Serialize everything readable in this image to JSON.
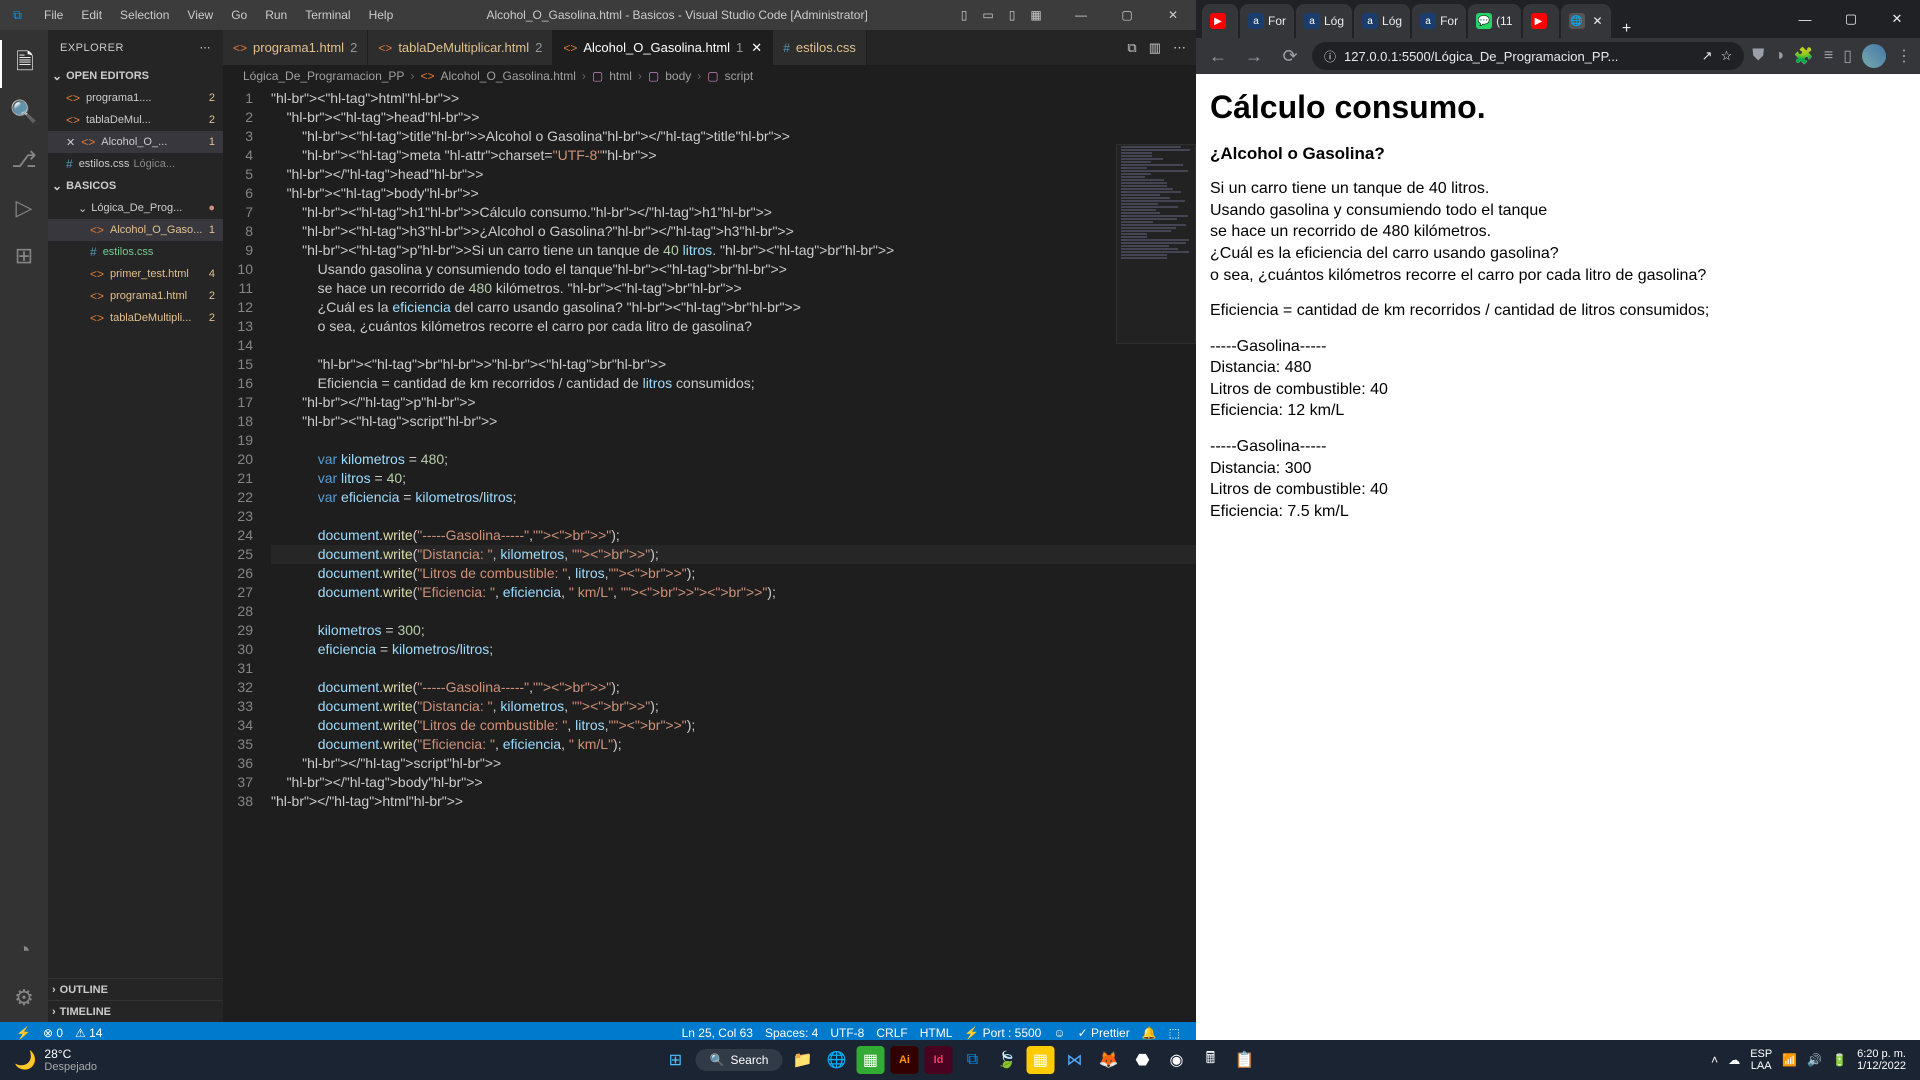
{
  "vscode": {
    "title": "Alcohol_O_Gasolina.html - Basicos - Visual Studio Code [Administrator]",
    "menu": [
      "File",
      "Edit",
      "Selection",
      "View",
      "Go",
      "Run",
      "Terminal",
      "Help"
    ],
    "explorer": {
      "title": "EXPLORER",
      "open_editors": "OPEN EDITORS",
      "workspace": "BASICOS",
      "folder": "Lógica_De_Prog...",
      "editors": [
        {
          "name": "programa1....",
          "badge": "2",
          "icon": "<>"
        },
        {
          "name": "tablaDeMul...",
          "badge": "2",
          "icon": "<>"
        },
        {
          "name": "Alcohol_O_...",
          "badge": "1",
          "icon": "<>",
          "sel": true,
          "close": true
        },
        {
          "name": "estilos.css",
          "sub": "Lógica...",
          "icon": "#",
          "blue": true
        }
      ],
      "files": [
        {
          "name": "Alcohol_O_Gaso...",
          "badge": "1",
          "cls": "git-m",
          "sel": true
        },
        {
          "name": "estilos.css",
          "icon": "#",
          "blue": true,
          "cls": "git-u"
        },
        {
          "name": "primer_test.html",
          "badge": "4",
          "cls": "git-m"
        },
        {
          "name": "programa1.html",
          "badge": "2",
          "cls": "git-m"
        },
        {
          "name": "tablaDeMultipli...",
          "badge": "2",
          "cls": "git-m"
        }
      ],
      "outline": "OUTLINE",
      "timeline": "TIMELINE"
    },
    "tabs": [
      {
        "name": "programa1.html",
        "badge": "2"
      },
      {
        "name": "tablaDeMultiplicar.html",
        "badge": "2"
      },
      {
        "name": "Alcohol_O_Gasolina.html",
        "badge": "1",
        "active": true,
        "close": true
      },
      {
        "name": "estilos.css",
        "blue": true,
        "icon": "#"
      }
    ],
    "breadcrumb": [
      "Lógica_De_Programacion_PP",
      "Alcohol_O_Gasolina.html",
      "html",
      "body",
      "script"
    ],
    "status": {
      "remote": "⚡",
      "err": "⊗ 0",
      "warn": "⚠ 14",
      "pos": "Ln 25, Col 63",
      "spaces": "Spaces: 4",
      "enc": "UTF-8",
      "eol": "CRLF",
      "lang": "HTML",
      "port": "⚡ Port : 5500",
      "prettier": "✓ Prettier"
    }
  },
  "browser": {
    "tabs": [
      {
        "ic": "▶",
        "bg": "#f00",
        "txt": ""
      },
      {
        "ic": "a",
        "bg": "#1a3d6d",
        "txt": "For"
      },
      {
        "ic": "a",
        "bg": "#1a3d6d",
        "txt": "Lóg"
      },
      {
        "ic": "a",
        "bg": "#1a3d6d",
        "txt": "Lóg"
      },
      {
        "ic": "a",
        "bg": "#1a3d6d",
        "txt": "For"
      },
      {
        "ic": "💬",
        "bg": "#25d366",
        "txt": "(11"
      },
      {
        "ic": "▶",
        "bg": "#f00",
        "txt": ""
      },
      {
        "ic": "🌐",
        "bg": "#555",
        "txt": "",
        "active": true,
        "close": true
      }
    ],
    "url": "127.0.0.1:5500/Lógica_De_Programacion_PP...",
    "page": {
      "h1": "Cálculo consumo.",
      "h3": "¿Alcohol o Gasolina?",
      "p1_l1": "Si un carro tiene un tanque de 40 litros.",
      "p1_l2": "Usando gasolina y consumiendo todo el tanque",
      "p1_l3": "se hace un recorrido de 480 kilómetros.",
      "p1_l4": "¿Cuál es la eficiencia del carro usando gasolina?",
      "p1_l5": "o sea, ¿cuántos kilómetros recorre el carro por cada litro de gasolina?",
      "p2": "Eficiencia = cantidad de km recorridos / cantidad de litros consumidos;",
      "g1_hdr": "-----Gasolina-----",
      "g1_d": "Distancia: 480",
      "g1_l": "Litros de combustible: 40",
      "g1_e": "Eficiencia: 12 km/L",
      "g2_hdr": "-----Gasolina-----",
      "g2_d": "Distancia: 300",
      "g2_l": "Litros de combustible: 40",
      "g2_e": "Eficiencia: 7.5 km/L"
    }
  },
  "taskbar": {
    "temp": "28°C",
    "cond": "Despejado",
    "search": "Search",
    "lang": "ESP",
    "loc": "LAA",
    "time": "6:20 p. m.",
    "date": "1/12/2022"
  },
  "code_lines": [
    "<html>",
    "    <head>",
    "        <title>Alcohol o Gasolina</title>",
    "        <meta charset=\"UTF-8\">",
    "    </head>",
    "    <body>",
    "        <h1>Cálculo consumo.</h1>",
    "        <h3>¿Alcohol o Gasolina?</h3>",
    "        <p>Si un carro tiene un tanque de 40 litros. <br>",
    "            Usando gasolina y consumiendo todo el tanque<br>",
    "            se hace un recorrido de 480 kilómetros. <br>",
    "            ¿Cuál es la eficiencia del carro usando gasolina? <br>",
    "            o sea, ¿cuántos kilómetros recorre el carro por cada litro de gasolina?",
    "            ",
    "            <br><br>",
    "            Eficiencia = cantidad de km recorridos / cantidad de litros consumidos;",
    "        </p>",
    "        <script>",
    "",
    "            var kilometros = 480;",
    "            var litros = 40;",
    "            var eficiencia = kilometros/litros;",
    "",
    "            document.write(\"-----Gasolina-----\",\"<br>\");",
    "            document.write(\"Distancia: \", kilometros, \"<br>\");",
    "            document.write(\"Litros de combustible: \", litros,\"<br>\");",
    "            document.write(\"Eficiencia: \", eficiencia, \" km/L\", \"<br><br>\");",
    "",
    "            kilometros = 300;",
    "            eficiencia = kilometros/litros;",
    "",
    "            document.write(\"-----Gasolina-----\",\"<br>\");",
    "            document.write(\"Distancia: \", kilometros, \"<br>\");",
    "            document.write(\"Litros de combustible: \", litros,\"<br>\");",
    "            document.write(\"Eficiencia: \", eficiencia, \" km/L\");",
    "        </script>",
    "    </body>",
    "</html>"
  ]
}
